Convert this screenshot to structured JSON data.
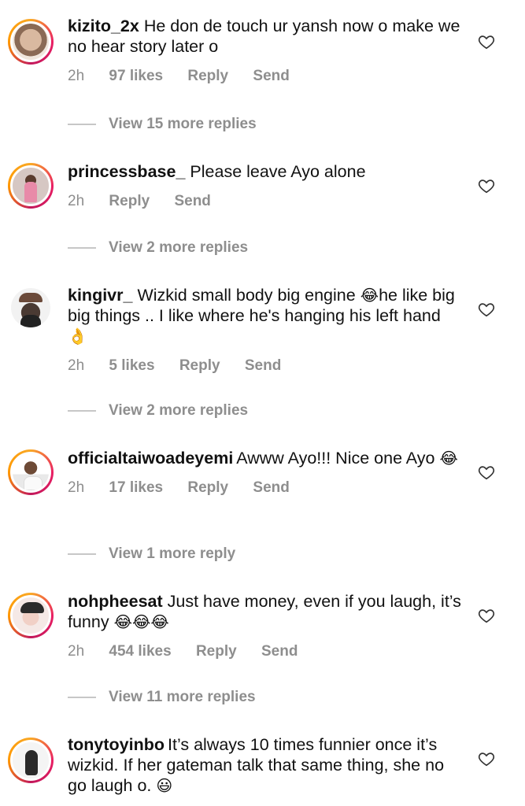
{
  "comments": [
    {
      "username": "kizito_2x",
      "text": "He don de touch ur yansh now o make we no hear story later o",
      "time": "2h",
      "likes": "97 likes",
      "reply_label": "Reply",
      "send_label": "Send",
      "view_replies": "View 15 more replies"
    },
    {
      "username": "princessbase_",
      "text": "Please leave Ayo alone",
      "time": "2h",
      "reply_label": "Reply",
      "send_label": "Send",
      "view_replies": "View 2 more replies"
    },
    {
      "username": "kingivr_",
      "text_a": "Wizkid small body big engine",
      "emoji_a": "😂",
      "text_b": "he like big big things .. I like where he's hanging his left hand",
      "emoji_b": "👌",
      "time": "2h",
      "likes": "5 likes",
      "reply_label": "Reply",
      "send_label": "Send",
      "view_replies": "View 2 more replies"
    },
    {
      "username": "officialtaiwoadeyemi",
      "text": "Awww Ayo!!! Nice one Ayo",
      "emoji": "😂",
      "time": "2h",
      "likes": "17 likes",
      "reply_label": "Reply",
      "send_label": "Send",
      "view_replies": "View 1 more reply"
    },
    {
      "username": "nohpheesat",
      "text": "Just have money, even if you laugh, it’s funny",
      "emoji": "😂😂😂",
      "time": "2h",
      "likes": "454 likes",
      "reply_label": "Reply",
      "send_label": "Send",
      "view_replies": "View 11 more replies"
    },
    {
      "username": "tonytoyinbo",
      "text": "It’s always 10 times funnier once it’s wizkid. If her gateman talk that same thing, she no go laugh o.",
      "emoji": "😃"
    }
  ],
  "icons": {
    "heart": "heart-outline-icon"
  },
  "colors": {
    "meta": "#8e8e8e",
    "story_ring": "#e91e63"
  }
}
